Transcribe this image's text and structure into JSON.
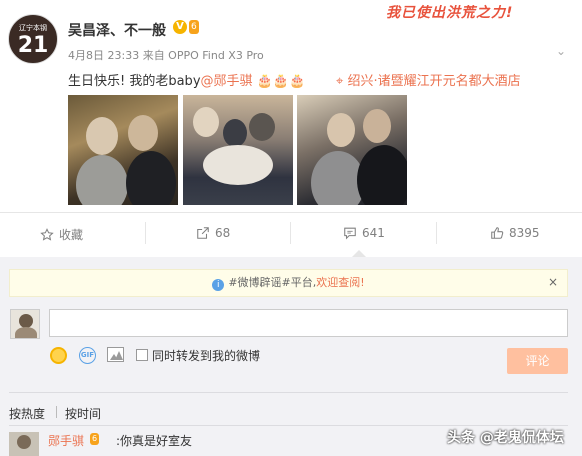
{
  "post": {
    "avatar": {
      "team_text": "辽宁本钢",
      "number": "21"
    },
    "username": "吴昌泽、不一般",
    "verified_badge": "V",
    "level_badge": "6",
    "meta": "4月8日 23:33 来自 OPPO Find X3 Pro",
    "content_text": "生日快乐! 我的老baby",
    "mention": "@郧手骐",
    "content_emoji": "🎂🎂🎂",
    "location": "绍兴·诸暨耀江开元名都大酒店",
    "watermark": "我已使出洪荒之力!"
  },
  "actions": {
    "favorite_label": "收藏",
    "repost_count": "68",
    "comment_count": "641",
    "like_count": "8395"
  },
  "comment_box": {
    "notice_pre": "#微博辟谣#平台,",
    "notice_link": "欢迎查阅!",
    "notice_close": "×",
    "input_placeholder": "",
    "gif_label": "GIF",
    "repost_option": "同时转发到我的微博",
    "submit_label": "评论"
  },
  "sort": {
    "hot": "按热度",
    "time": "按时间"
  },
  "first_comment": {
    "user": "郧手骐",
    "level_badge": "6",
    "text": ":你真是好室友"
  },
  "overlay_watermark": "头条 @老鬼侃体坛",
  "icons": {
    "favorite": "star-icon",
    "repost": "share-icon",
    "comment": "comment-icon",
    "like": "thumbs-up-icon",
    "location": "location-pin-icon",
    "info": "info-icon"
  },
  "colors": {
    "accent": "#eb7350",
    "submit_bg": "#ffc09f",
    "notice_bg": "#fffde9",
    "comment_area_bg": "#f2f2f5"
  }
}
